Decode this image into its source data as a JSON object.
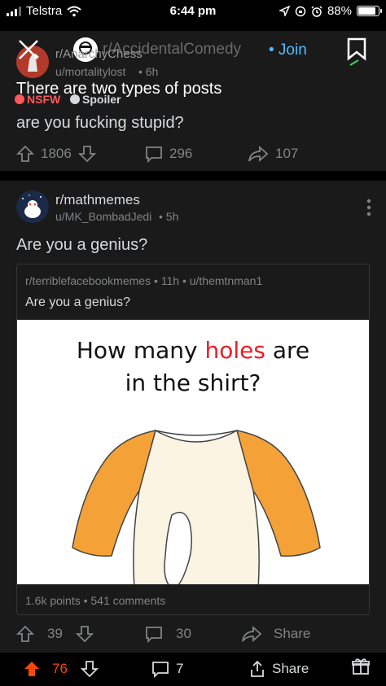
{
  "status_bar": {
    "carrier": "Telstra",
    "time": "6:44 pm",
    "battery": "88%"
  },
  "overlay_post": {
    "subreddit_faded": "r/AccidentalComedy",
    "subreddit": "r/AnarchyChess",
    "join_label": "• Join",
    "title": "There are two types of posts",
    "nsfw_label": "NSFW",
    "spoiler_label": "Spoiler"
  },
  "post1": {
    "user": "u/mortalitylost",
    "age": "• 6h",
    "body": "are you fucking stupid?",
    "upvotes": "1806",
    "comments": "296",
    "shares": "107"
  },
  "post2": {
    "subreddit": "r/mathmemes",
    "user": "u/MK_BombadJedi",
    "age": "• 5h",
    "title": "Are you a genius?",
    "crosspost": {
      "meta": "r/terriblefacebookmemes • 11h • u/themtnman1",
      "title": "Are you a genius?",
      "meme_line1_a": "How many ",
      "meme_line1_hl": "holes",
      "meme_line1_b": " are",
      "meme_line2": "in the shirt?",
      "points": "1.6k points • 541 comments"
    },
    "upvotes": "39",
    "comments": "30",
    "share_label": "Share"
  },
  "bottom_bar": {
    "upvotes": "76",
    "comments": "7",
    "share_label": "Share"
  },
  "colors": {
    "card": "#1a1a1b",
    "accent_blue": "#4fbcff",
    "upvote_orange": "#ff4500",
    "nsfw_red": "#ff585b",
    "join_green": "#46d160"
  },
  "icons": [
    "signal-icon",
    "wifi-icon",
    "location-icon",
    "lock-rotation-icon",
    "alarm-icon",
    "battery-icon",
    "close-icon",
    "bookmark-icon",
    "upvote-icon",
    "downvote-icon",
    "comment-icon",
    "share-icon",
    "more-icon",
    "award-icon"
  ]
}
